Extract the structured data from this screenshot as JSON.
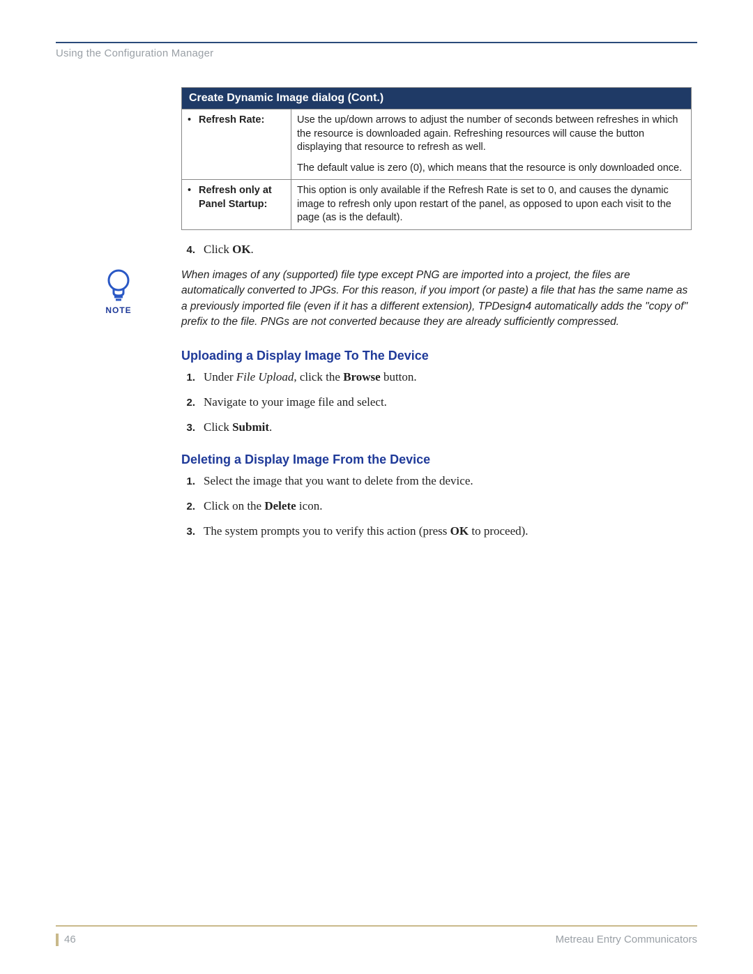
{
  "header": {
    "running_head": "Using the Configuration Manager"
  },
  "table": {
    "title": "Create Dynamic Image dialog (Cont.)",
    "rows": [
      {
        "label": "Refresh Rate:",
        "desc_p1": "Use the up/down arrows to adjust the number of seconds between refreshes in which the resource is downloaded again. Refreshing resources will cause the button displaying that resource to refresh as well.",
        "desc_p2": "The default value is zero (0), which means that the resource is only downloaded once."
      },
      {
        "label": "Refresh only at Panel Startup:",
        "desc_p1": "This option is only available if the Refresh Rate is set to 0, and causes the dynamic image to refresh only upon restart of the panel, as opposed to upon each visit to the page (as is the default)."
      }
    ]
  },
  "step4": {
    "num": "4.",
    "pre": "Click ",
    "bold": "OK",
    "post": "."
  },
  "note": {
    "label": "NOTE",
    "text": "When images of any (supported) file type except PNG are imported into a project, the files are automatically converted to JPGs. For this reason, if you import (or paste) a file that has the same name as a previously imported file (even if it has a different extension), TPDesign4 automatically adds the \"copy of\" prefix to the file. PNGs are not converted because they are already sufficiently compressed."
  },
  "section_upload": {
    "heading": "Uploading a Display Image To The Device",
    "steps": [
      {
        "num": "1.",
        "parts": [
          {
            "t": "Under ",
            "c": ""
          },
          {
            "t": "File Upload",
            "c": "ital"
          },
          {
            "t": ", click the ",
            "c": ""
          },
          {
            "t": "Browse",
            "c": "bold"
          },
          {
            "t": " button.",
            "c": ""
          }
        ]
      },
      {
        "num": "2.",
        "parts": [
          {
            "t": "Navigate to your image file and select.",
            "c": ""
          }
        ]
      },
      {
        "num": "3.",
        "parts": [
          {
            "t": "Click ",
            "c": ""
          },
          {
            "t": "Submit",
            "c": "bold"
          },
          {
            "t": ".",
            "c": ""
          }
        ]
      }
    ]
  },
  "section_delete": {
    "heading": "Deleting a Display Image From the Device",
    "steps": [
      {
        "num": "1.",
        "parts": [
          {
            "t": "Select the image that you want to delete from the device.",
            "c": ""
          }
        ]
      },
      {
        "num": "2.",
        "parts": [
          {
            "t": "Click on the ",
            "c": ""
          },
          {
            "t": "Delete",
            "c": "bold"
          },
          {
            "t": " icon.",
            "c": ""
          }
        ]
      },
      {
        "num": "3.",
        "parts": [
          {
            "t": "The system prompts you to verify this action (press ",
            "c": ""
          },
          {
            "t": "OK",
            "c": "bold"
          },
          {
            "t": " to proceed).",
            "c": ""
          }
        ]
      }
    ]
  },
  "footer": {
    "page_no": "46",
    "book": "Metreau Entry Communicators"
  }
}
